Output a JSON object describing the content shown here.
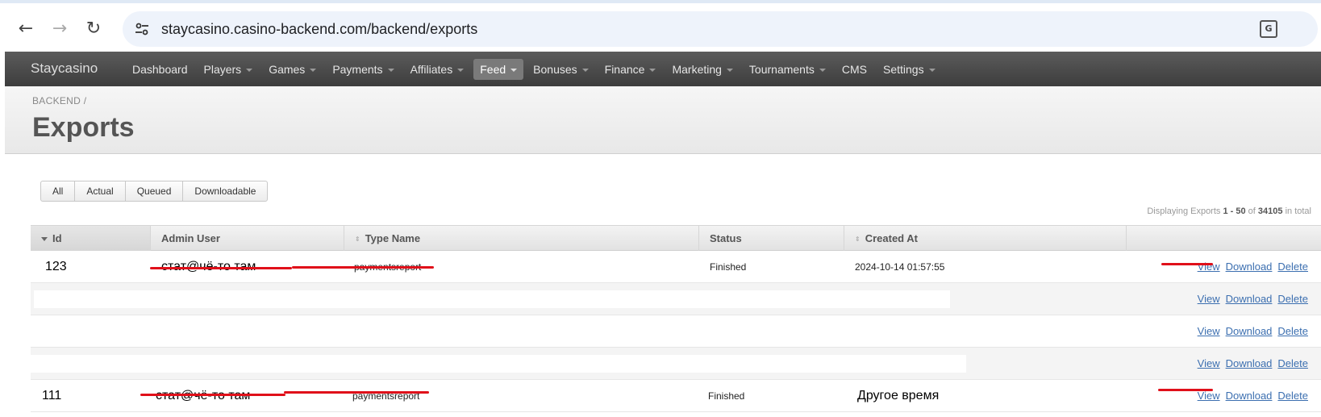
{
  "browser": {
    "url": "staycasino.casino-backend.com/backend/exports",
    "back_icon": "arrow-left-icon",
    "forward_icon": "arrow-right-icon",
    "reload_icon": "reload-icon",
    "site_info_icon": "tune-icon",
    "translate_icon": "translate-icon"
  },
  "navbar": {
    "brand": "Staycasino",
    "items": [
      {
        "label": "Dashboard",
        "caret": false,
        "active": false
      },
      {
        "label": "Players",
        "caret": true,
        "active": false
      },
      {
        "label": "Games",
        "caret": true,
        "active": false
      },
      {
        "label": "Payments",
        "caret": true,
        "active": false
      },
      {
        "label": "Affiliates",
        "caret": true,
        "active": false
      },
      {
        "label": "Feed",
        "caret": true,
        "active": true
      },
      {
        "label": "Bonuses",
        "caret": true,
        "active": false
      },
      {
        "label": "Finance",
        "caret": true,
        "active": false
      },
      {
        "label": "Marketing",
        "caret": true,
        "active": false
      },
      {
        "label": "Tournaments",
        "caret": true,
        "active": false
      },
      {
        "label": "CMS",
        "caret": false,
        "active": false
      },
      {
        "label": "Settings",
        "caret": true,
        "active": false
      }
    ]
  },
  "header": {
    "breadcrumb": "BACKEND /",
    "title": "Exports"
  },
  "scopes": [
    "All",
    "Actual",
    "Queued",
    "Downloadable"
  ],
  "info": {
    "prefix": "Displaying Exports",
    "range": "1 - 50",
    "of": "of",
    "total": "34105",
    "suffix": "in total"
  },
  "table": {
    "columns": [
      "Id",
      "Admin User",
      "Type Name",
      "Status",
      "Created At"
    ],
    "actions": {
      "view": "View",
      "download": "Download",
      "delete": "Delete"
    },
    "rows": [
      {
        "id": "123",
        "admin_user": "стат@чё-то там",
        "type_name": "paymentsreport",
        "status": "Finished",
        "created_at": "2024-10-14 01:57:55"
      },
      {
        "id": "",
        "admin_user": "",
        "type_name": "",
        "status": "",
        "created_at": ""
      },
      {
        "id": "",
        "admin_user": "",
        "type_name": "",
        "status": "",
        "created_at": ""
      },
      {
        "id": "",
        "admin_user": "",
        "type_name": "",
        "status": "",
        "created_at": ""
      },
      {
        "id": "111",
        "admin_user": "стат@чё-то там",
        "type_name": "paymentsreport",
        "status": "Finished",
        "created_at": "Другое время"
      }
    ]
  },
  "colors": {
    "navbar": "#4a4a4a",
    "link": "#3c6fb0",
    "annotation": "#e0101a"
  }
}
